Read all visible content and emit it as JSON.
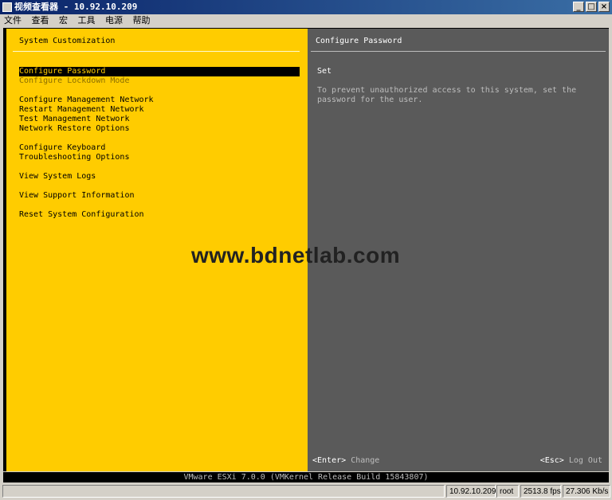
{
  "window": {
    "title": "视频查看器 - 10.92.10.209",
    "buttons": {
      "minimize": "_",
      "maximize": "□",
      "close": "×"
    }
  },
  "menubar": {
    "items": [
      "文件",
      "查看",
      "宏",
      "工具",
      "电源",
      "帮助"
    ]
  },
  "left_pane": {
    "header": "System Customization",
    "items": [
      {
        "label": "Configure Password",
        "state": "selected"
      },
      {
        "label": "Configure Lockdown Mode",
        "state": "disabled"
      },
      {
        "label": "Configure Management Network",
        "state": "normal"
      },
      {
        "label": "Restart Management Network",
        "state": "normal"
      },
      {
        "label": "Test Management Network",
        "state": "normal"
      },
      {
        "label": "Network Restore Options",
        "state": "normal"
      },
      {
        "label": "Configure Keyboard",
        "state": "normal"
      },
      {
        "label": "Troubleshooting Options",
        "state": "normal"
      },
      {
        "label": "View System Logs",
        "state": "normal"
      },
      {
        "label": "View Support Information",
        "state": "normal"
      },
      {
        "label": "Reset System Configuration",
        "state": "normal"
      }
    ]
  },
  "right_pane": {
    "header": "Configure Password",
    "detail_title": "Set",
    "detail_desc": "To prevent unauthorized access to this system, set the password for the user.",
    "footer_enter_key": "<Enter>",
    "footer_enter_action": "Change",
    "footer_esc_key": "<Esc>",
    "footer_esc_action": "Log Out"
  },
  "watermark": "www.bdnetlab.com",
  "version": "VMware ESXi 7.0.0 (VMKernel Release Build 15843807)",
  "statusbar": {
    "host": "10.92.10.209",
    "user": "root",
    "fps": "2513.8 fps",
    "rate": "27.306 Kb/s"
  },
  "colors": {
    "left_bg": "#ffcc00",
    "right_bg": "#5a5a5a",
    "titlebar": "#0a246a"
  }
}
